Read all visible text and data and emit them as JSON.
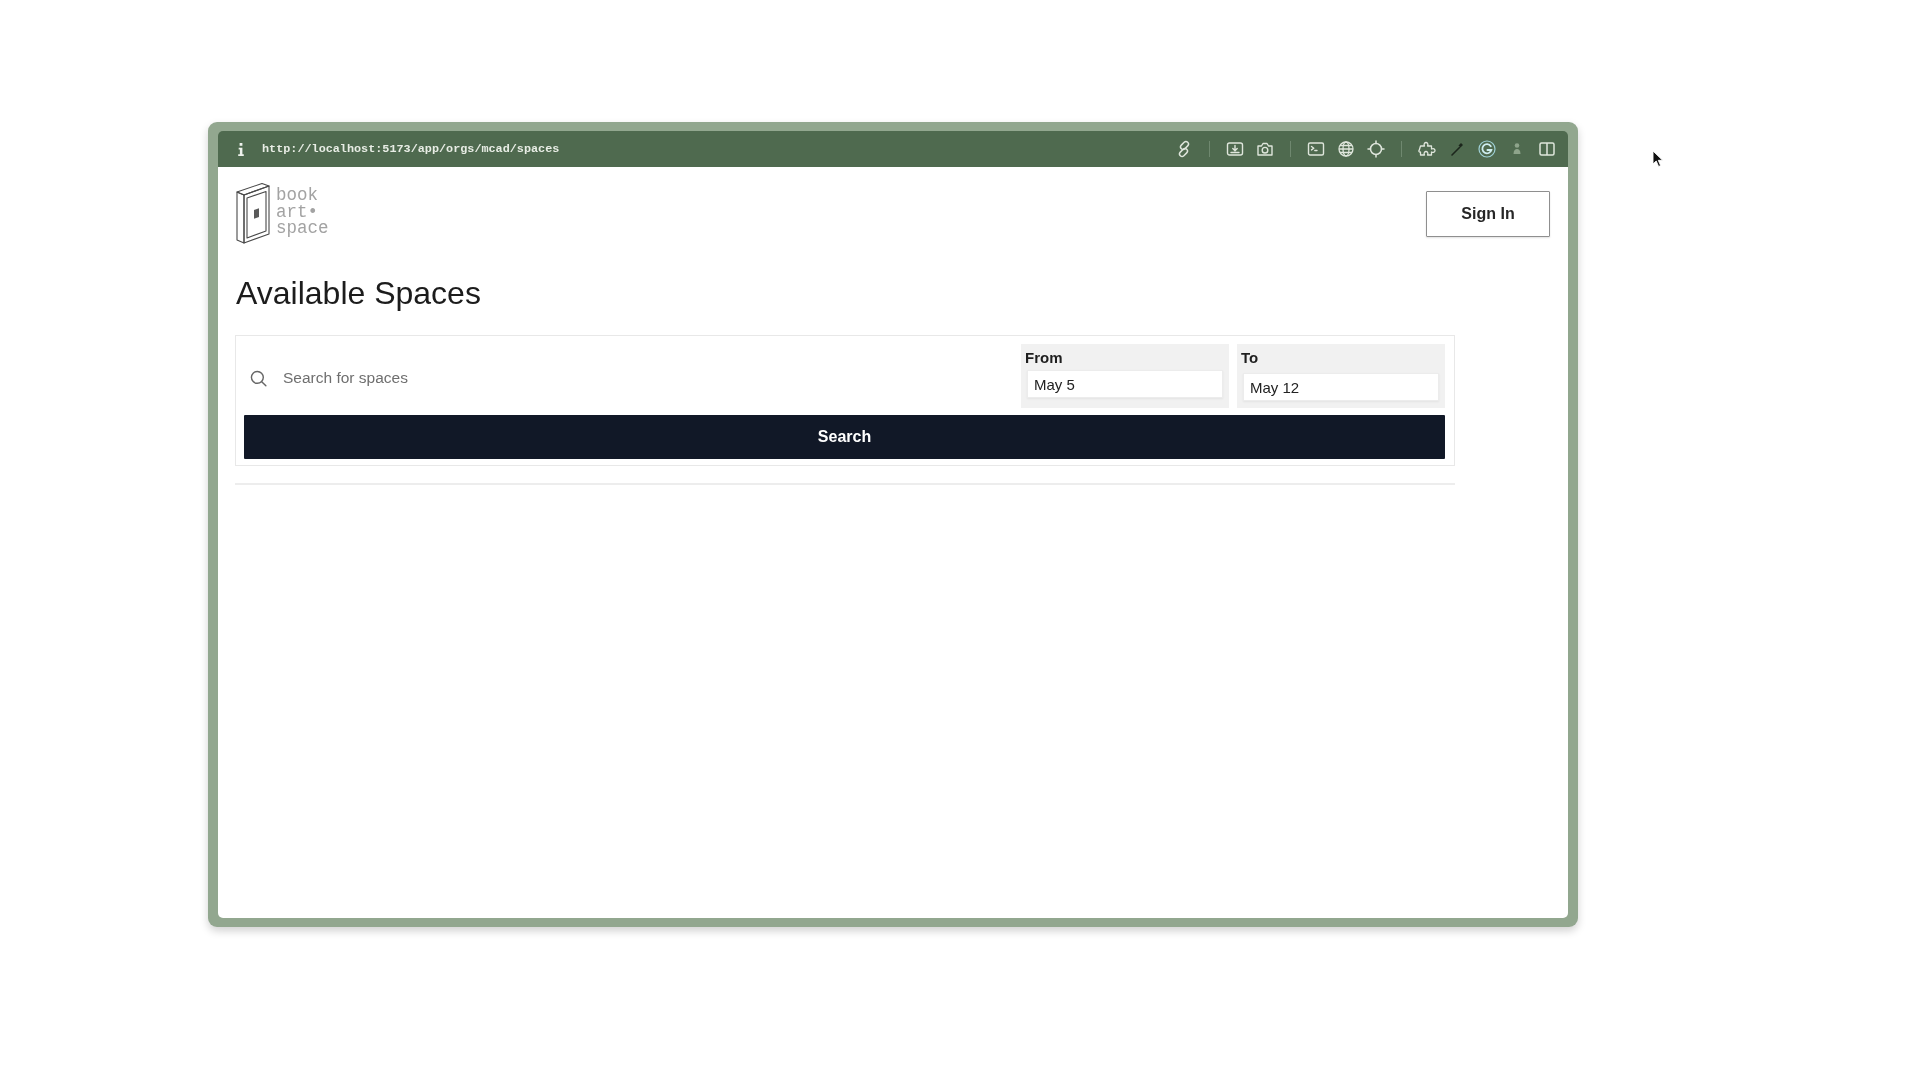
{
  "browser": {
    "url": "http://localhost:5173/app/orgs/mcad/spaces"
  },
  "header": {
    "logo_lines": [
      "book",
      "art•",
      "space"
    ],
    "sign_in_button": "Sign In"
  },
  "page_title": "Available Spaces",
  "search": {
    "placeholder": "Search for spaces",
    "date_fields": [
      {
        "label": "From",
        "value": "May 5"
      },
      {
        "label": "To",
        "value": "May 12"
      }
    ],
    "button": "Search"
  }
}
